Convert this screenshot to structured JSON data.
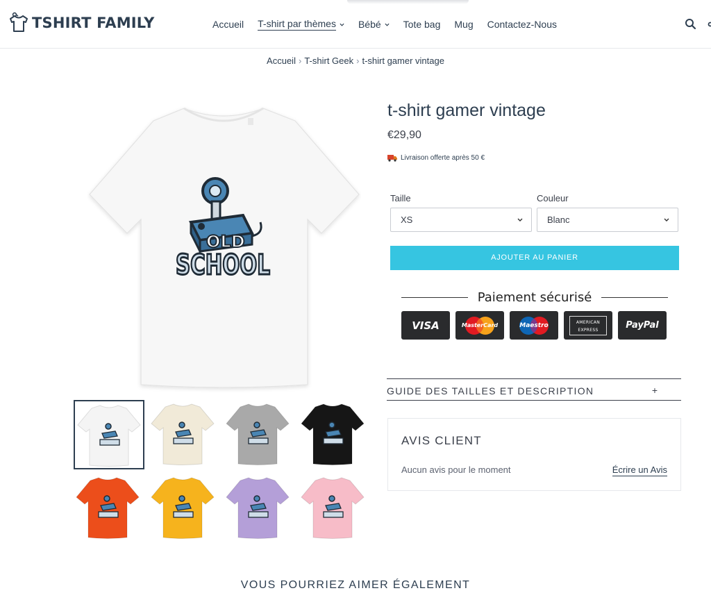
{
  "header": {
    "logo_text": "TSHIRT FAMILY",
    "nav": [
      {
        "label": "Accueil",
        "dropdown": false,
        "active": false
      },
      {
        "label": "T-shirt par thèmes",
        "dropdown": true,
        "active": true
      },
      {
        "label": "Bébé",
        "dropdown": true,
        "active": false
      },
      {
        "label": "Tote bag",
        "dropdown": false,
        "active": false
      },
      {
        "label": "Mug",
        "dropdown": false,
        "active": false
      },
      {
        "label": "Contactez-Nous",
        "dropdown": false,
        "active": false
      }
    ]
  },
  "breadcrumb": [
    "Accueil",
    "T-shirt Geek",
    "t-shirt gamer vintage"
  ],
  "product": {
    "title": "t-shirt gamer vintage",
    "price": "€29,90",
    "shipping": "Livraison offerte après 50 €",
    "size_label": "Taille",
    "size_value": "XS",
    "color_label": "Couleur",
    "color_value": "Blanc",
    "add_to_cart": "AJOUTER AU PANIER",
    "payment_title": "Paiement sécurisé",
    "payment_methods": [
      "VISA",
      "MasterCard",
      "Maestro",
      "AMERICAN EXPRESS",
      "PayPal"
    ],
    "graphic_text": [
      "OLD",
      "SCHOOL"
    ],
    "thumbnail_colors": [
      "#f4f4f4",
      "#f1ead8",
      "#a9a9a9",
      "#161616",
      "#ec4e1b",
      "#f6b31d",
      "#b49fd8",
      "#f7bcc8"
    ]
  },
  "accordion": {
    "label": "GUIDE DES TAILLES ET DESCRIPTION",
    "icon": "+"
  },
  "reviews": {
    "title": "AVIS CLIENT",
    "empty_text": "Aucun avis pour le moment",
    "write_link": "Écrire un Avis"
  },
  "recommendations_title": "VOUS POURRIEZ AIMER ÉGALEMENT",
  "colors": {
    "accent": "#36c5e1",
    "navy": "#2d3e50",
    "graphic_blue": "#4a86b4"
  }
}
